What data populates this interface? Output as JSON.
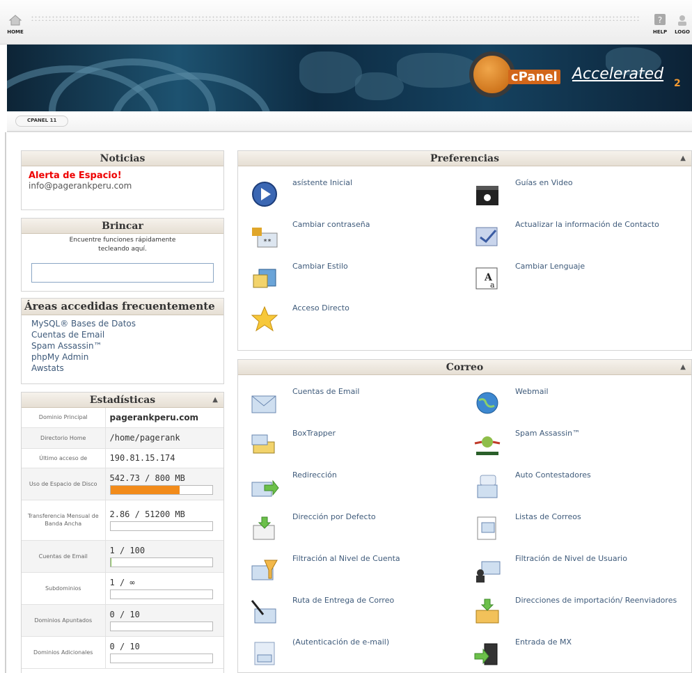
{
  "topbar": {
    "home_label": "HOME",
    "help_label": "HELP",
    "logout_label": "LOGO"
  },
  "banner": {
    "logo_text": "cPanel",
    "logo_accelerated": "Accelerated",
    "logo_sub": "2"
  },
  "tab": {
    "label": "CPANEL 11"
  },
  "news": {
    "title": "Noticias",
    "alert": "Alerta de Espacio!",
    "email": "info@pagerankperu.com"
  },
  "jump": {
    "title": "Brincar",
    "description_line1": "Encuentre funciones rápidamente",
    "description_line2": "tecleando aquí.",
    "input_value": ""
  },
  "frequent": {
    "title": "Áreas accedidas frecuentemente",
    "items": [
      "MySQL® Bases de Datos",
      "Cuentas de Email",
      "Spam Assassin™",
      "phpMy Admin",
      "Awstats"
    ]
  },
  "stats": {
    "title": "Estadísticas",
    "rows": [
      {
        "label": "Dominio Principal",
        "value": "pagerankperu.com"
      },
      {
        "label": "Directorio Home",
        "value": "/home/pagerank"
      },
      {
        "label": "Último acceso de",
        "value": "190.81.15.174"
      },
      {
        "label": "Uso de Espacio de Disco",
        "value": "542.73 / 800 MB",
        "usage": 0.68
      },
      {
        "label": "Transferencia Mensual de Banda Ancha",
        "value": "2.86 / 51200 MB",
        "usage": 0.0
      },
      {
        "label": "Cuentas de Email",
        "value": "1 / 100",
        "usage": 0.01
      },
      {
        "label": "Subdominios",
        "value": "1 / ∞",
        "usage": 0.0
      },
      {
        "label": "Dominios Apuntados",
        "value": "0 / 10",
        "usage": 0.0
      },
      {
        "label": "Dominios Adicionales",
        "value": "0 / 10",
        "usage": 0.0
      }
    ]
  },
  "preferences": {
    "title": "Preferencias",
    "items": [
      "asístente Inicial",
      "Guías en Video",
      "Cambiar contraseña",
      "Actualizar la información de Contacto",
      "Cambiar Estilo",
      "Cambiar Lenguaje",
      "Acceso Directo"
    ]
  },
  "mail": {
    "title": "Correo",
    "items": [
      "Cuentas de Email",
      "Webmail",
      "BoxTrapper",
      "Spam Assassin™",
      "Redirección",
      "Auto Contestadores",
      "Dirección por Defecto",
      "Listas de Correos",
      "Filtración al Nivel de Cuenta",
      "Filtración de Nivel de Usuario",
      "Ruta de Entrega de Correo",
      "Direcciones de importación/ Reenviadores",
      "(Autenticación de e-mail)",
      "Entrada de MX"
    ]
  },
  "colors": {
    "accent": "#3e5a7a",
    "alert": "#ee0000",
    "bar_fill": "#f28b1a"
  }
}
